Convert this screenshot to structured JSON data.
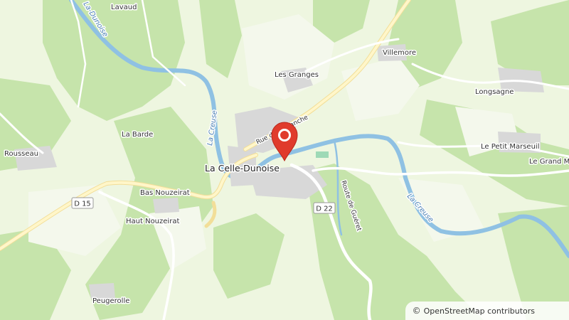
{
  "map": {
    "town": "La Celle-Dunoise",
    "places": {
      "lavaud": "Lavaud",
      "villemore": "Villemore",
      "les_granges": "Les Granges",
      "longsagne": "Longsagne",
      "la_barde": "La Barde",
      "rousseau": "Rousseau",
      "le_petit_marseuil": "Le Petit Marseuil",
      "le_grand_m": "Le Grand M",
      "bas_nouzeirat": "Bas Nouzeirat",
      "haut_nouzeirat": "Haut Nouzeirat",
      "peugerolle": "Peugerolle"
    },
    "rivers": {
      "dunoise": "La-Dunoise",
      "creuse_west": "La Creuse",
      "creuse_east": "La Creuse"
    },
    "roads": {
      "rue": "Rue de la Planche",
      "route_guéret": "Route de Guéret",
      "d15": "D 15",
      "d22": "D 22"
    },
    "colors": {
      "meadow": "#eaf4d8",
      "forest": "#c7e5ac",
      "river": "#8fc1e3",
      "marker": "#e03b2c"
    },
    "marker_icon": "location-pin-icon"
  },
  "attribution": {
    "symbol": "©",
    "text": "OpenStreetMap contributors"
  }
}
